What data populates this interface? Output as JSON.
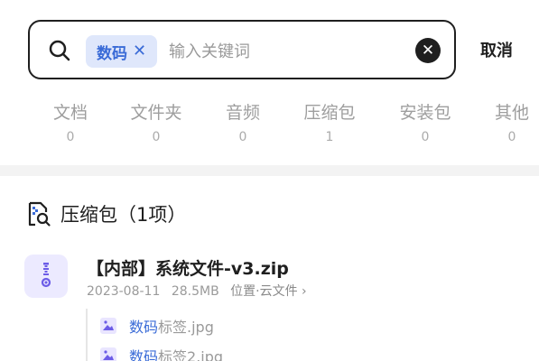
{
  "search": {
    "chip_label": "数码",
    "placeholder": "输入关键词",
    "cancel_label": "取消"
  },
  "tabs": [
    {
      "label": "文档",
      "count": "0"
    },
    {
      "label": "文件夹",
      "count": "0"
    },
    {
      "label": "音频",
      "count": "0"
    },
    {
      "label": "压缩包",
      "count": "1"
    },
    {
      "label": "安装包",
      "count": "0"
    },
    {
      "label": "其他",
      "count": "0"
    }
  ],
  "section": {
    "title": "压缩包（1项）"
  },
  "file": {
    "name": "【内部】系统文件-v3.zip",
    "date": "2023-08-11",
    "size": "28.5MB",
    "location": "位置·云文件 ›"
  },
  "sub_items": [
    {
      "highlight": "数码",
      "rest": "标签.jpg"
    },
    {
      "highlight": "数码",
      "rest": "标签2.jpg"
    }
  ],
  "colors": {
    "accent": "#3a6bd7",
    "chip_bg": "#dfe7fb",
    "icon_purple": "#6c5ce7"
  }
}
